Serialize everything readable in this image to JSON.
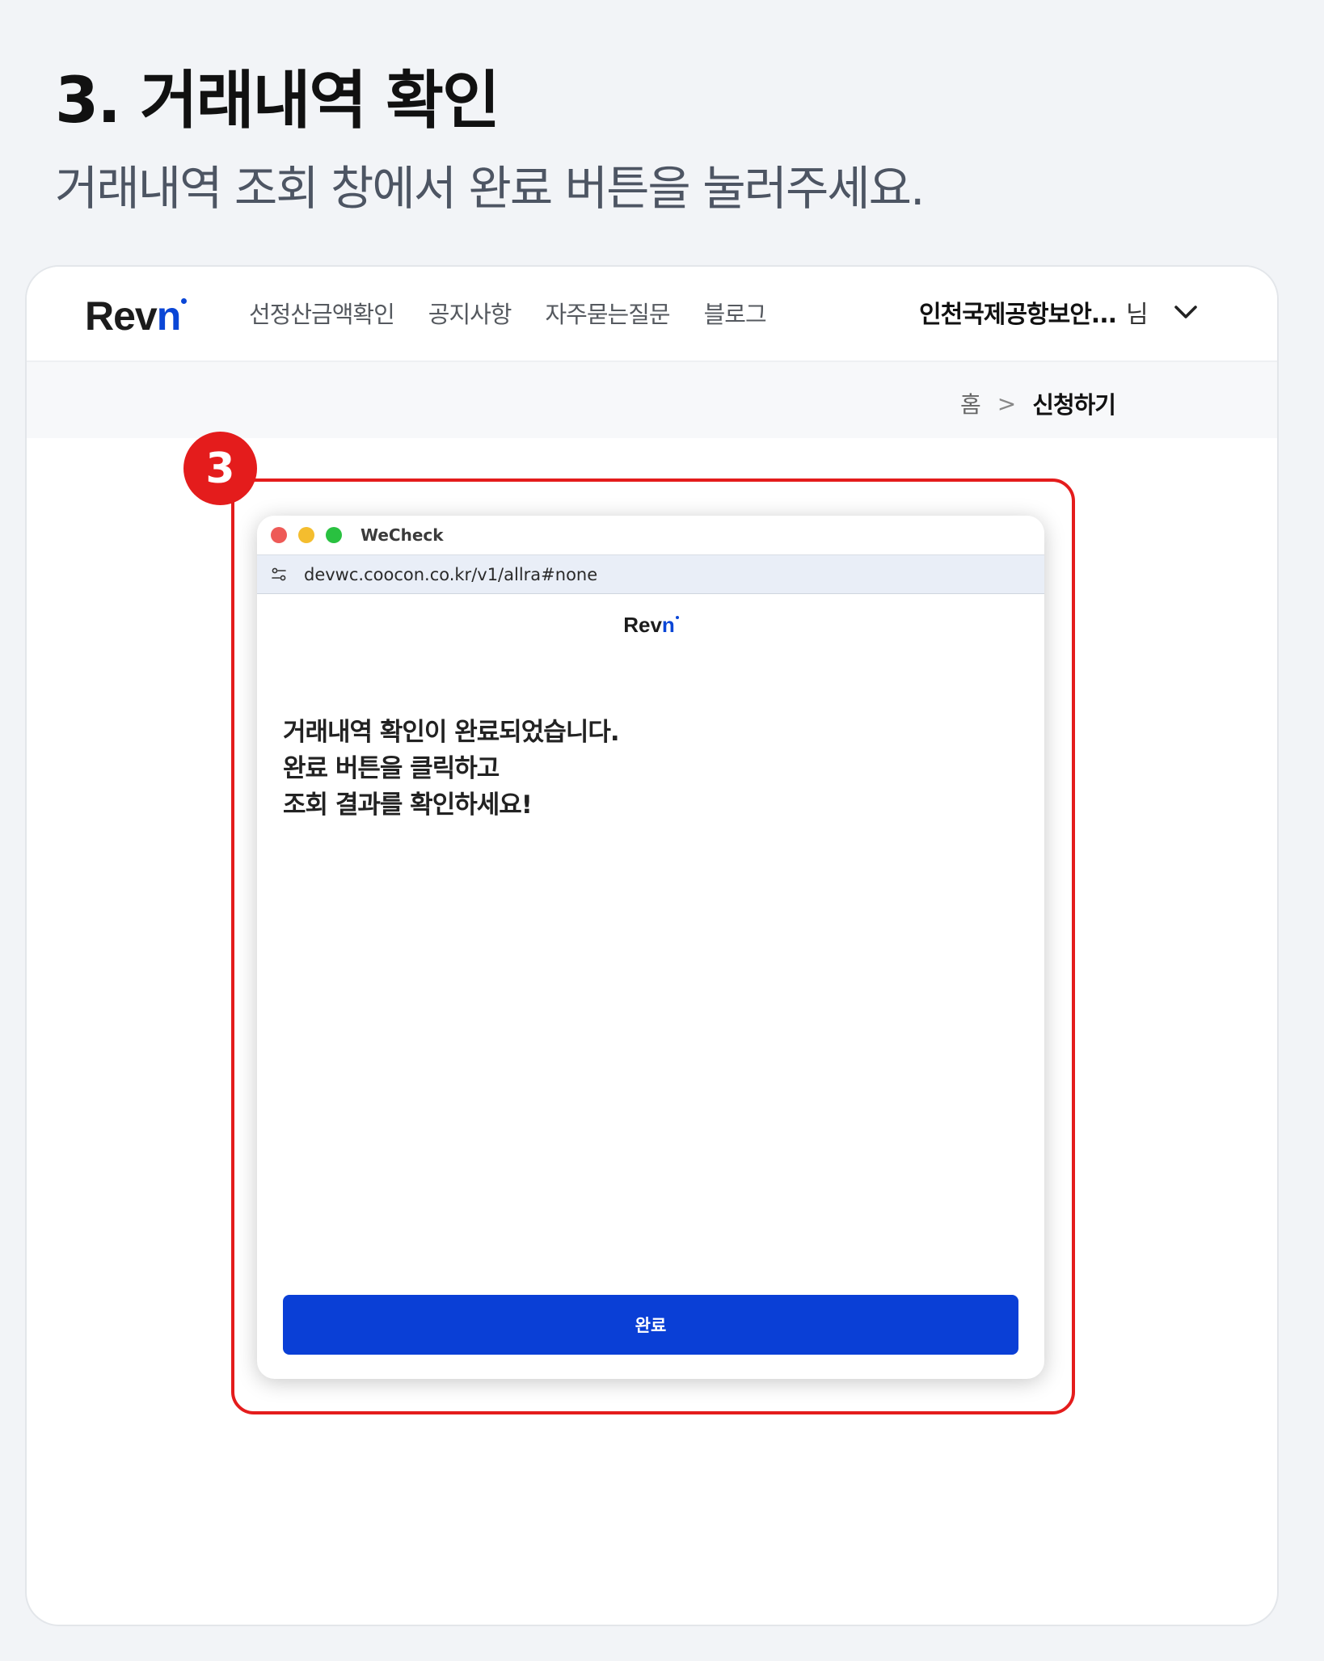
{
  "step": {
    "title": "3. 거래내역 확인",
    "subtitle": "거래내역 조회 창에서 완료 버튼을 눌러주세요."
  },
  "nav": {
    "logo": {
      "text": "Rev",
      "accent": "n"
    },
    "links": [
      "선정산금액확인",
      "공지사항",
      "자주묻는질문",
      "블로그"
    ],
    "user_name": "인천국제공항보안...",
    "user_suffix": "님"
  },
  "breadcrumb": {
    "home": "홈",
    "separator": ">",
    "current": "신청하기"
  },
  "badge_number": "3",
  "popup": {
    "window_title": "WeCheck",
    "url": "devwc.coocon.co.kr/v1/allra#none",
    "logo": {
      "text": "Rev",
      "accent": "n"
    },
    "message_lines": [
      "거래내역 확인이 완료되었습니다.",
      "완료 버튼을 클릭하고",
      "조회 결과를 확인하세요!"
    ],
    "done_button": "완료"
  },
  "colors": {
    "brand_blue": "#0a46d6",
    "highlight_red": "#e41c1c",
    "button_blue": "#0a3fd6"
  }
}
